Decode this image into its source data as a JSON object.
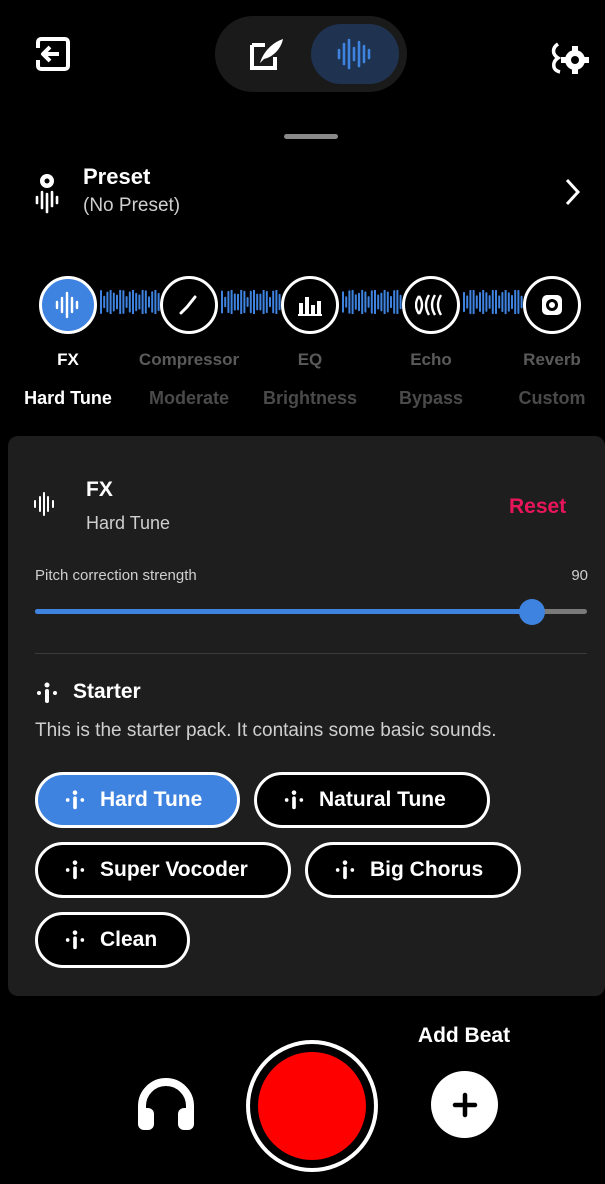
{
  "topbar": {
    "exit_icon": "exit-icon",
    "mode_write_icon": "feather-edit-icon",
    "mode_wave_icon": "waveform-icon",
    "settings_icon": "music-settings-icon"
  },
  "preset": {
    "title": "Preset",
    "subtitle": "(No Preset)",
    "icon": "preset-icon",
    "chevron": "chevron-right-icon"
  },
  "chain": [
    {
      "label": "FX",
      "value": "Hard Tune",
      "icon": "waveform-icon",
      "active": true
    },
    {
      "label": "Compressor",
      "value": "Moderate",
      "icon": "compressor-icon",
      "active": false
    },
    {
      "label": "EQ",
      "value": "Brightness",
      "icon": "eq-icon",
      "active": false
    },
    {
      "label": "Echo",
      "value": "Bypass",
      "icon": "echo-icon",
      "active": false
    },
    {
      "label": "Reverb",
      "value": "Custom",
      "icon": "reverb-icon",
      "active": false
    }
  ],
  "fx_panel": {
    "title": "FX",
    "subtitle": "Hard Tune",
    "reset_label": "Reset",
    "slider": {
      "label": "Pitch correction strength",
      "value": "90",
      "fraction": 0.9
    }
  },
  "pack": {
    "title": "Starter",
    "description": "This is the starter pack. It contains some basic sounds.",
    "chips": [
      {
        "label": "Hard Tune",
        "active": true
      },
      {
        "label": "Natural Tune",
        "active": false
      },
      {
        "label": "Super Vocoder",
        "active": false
      },
      {
        "label": "Big Chorus",
        "active": false
      },
      {
        "label": "Clean",
        "active": false
      }
    ]
  },
  "bottom": {
    "add_beat_label": "Add Beat",
    "headphones_icon": "headphones-icon",
    "record_button": "record-button",
    "add_icon": "plus-icon"
  },
  "colors": {
    "accent": "#3f83e0",
    "reset": "#e8155b",
    "record": "#ff0000",
    "card": "#1e1e1e"
  }
}
